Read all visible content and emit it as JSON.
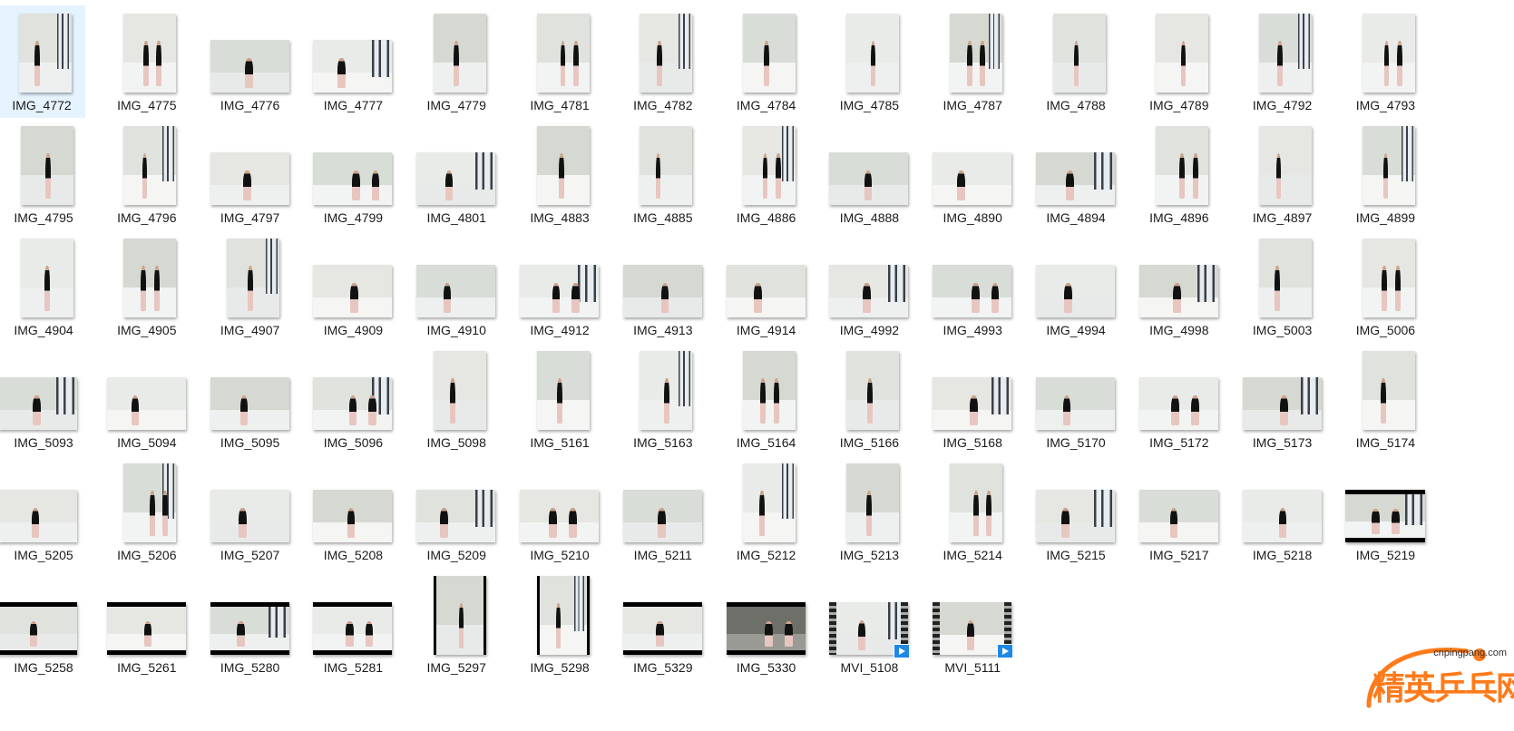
{
  "window": {
    "title": ""
  },
  "selected_index": 0,
  "colors": {
    "selection_bg": "#e5f3ff",
    "label_text": "#1a1a1a",
    "watermark_orange": "#ff7a1a",
    "video_badge": "#1e88e5"
  },
  "files": [
    {
      "name": "IMG_4772",
      "orientation": "portrait",
      "kind": "photo"
    },
    {
      "name": "IMG_4775",
      "orientation": "portrait",
      "kind": "photo"
    },
    {
      "name": "IMG_4776",
      "orientation": "landscape",
      "kind": "photo"
    },
    {
      "name": "IMG_4777",
      "orientation": "landscape",
      "kind": "photo"
    },
    {
      "name": "IMG_4779",
      "orientation": "portrait",
      "kind": "photo"
    },
    {
      "name": "IMG_4781",
      "orientation": "portrait",
      "kind": "photo"
    },
    {
      "name": "IMG_4782",
      "orientation": "portrait",
      "kind": "photo"
    },
    {
      "name": "IMG_4784",
      "orientation": "portrait",
      "kind": "photo"
    },
    {
      "name": "IMG_4785",
      "orientation": "portrait",
      "kind": "photo"
    },
    {
      "name": "IMG_4787",
      "orientation": "portrait",
      "kind": "photo"
    },
    {
      "name": "IMG_4788",
      "orientation": "portrait",
      "kind": "photo"
    },
    {
      "name": "IMG_4789",
      "orientation": "portrait",
      "kind": "photo"
    },
    {
      "name": "IMG_4792",
      "orientation": "portrait",
      "kind": "photo"
    },
    {
      "name": "IMG_4793",
      "orientation": "portrait",
      "kind": "photo"
    },
    {
      "name": "IMG_4795",
      "orientation": "portrait",
      "kind": "photo"
    },
    {
      "name": "IMG_4796",
      "orientation": "portrait",
      "kind": "photo"
    },
    {
      "name": "IMG_4797",
      "orientation": "landscape",
      "kind": "photo"
    },
    {
      "name": "IMG_4799",
      "orientation": "landscape",
      "kind": "photo"
    },
    {
      "name": "IMG_4801",
      "orientation": "landscape",
      "kind": "photo"
    },
    {
      "name": "IMG_4883",
      "orientation": "portrait",
      "kind": "photo"
    },
    {
      "name": "IMG_4885",
      "orientation": "portrait",
      "kind": "photo"
    },
    {
      "name": "IMG_4886",
      "orientation": "portrait",
      "kind": "photo"
    },
    {
      "name": "IMG_4888",
      "orientation": "landscape",
      "kind": "photo"
    },
    {
      "name": "IMG_4890",
      "orientation": "landscape",
      "kind": "photo"
    },
    {
      "name": "IMG_4894",
      "orientation": "landscape",
      "kind": "photo"
    },
    {
      "name": "IMG_4896",
      "orientation": "portrait",
      "kind": "photo"
    },
    {
      "name": "IMG_4897",
      "orientation": "portrait",
      "kind": "photo"
    },
    {
      "name": "IMG_4899",
      "orientation": "portrait",
      "kind": "photo"
    },
    {
      "name": "IMG_4904",
      "orientation": "portrait",
      "kind": "photo"
    },
    {
      "name": "IMG_4905",
      "orientation": "portrait",
      "kind": "photo"
    },
    {
      "name": "IMG_4907",
      "orientation": "portrait",
      "kind": "photo"
    },
    {
      "name": "IMG_4909",
      "orientation": "landscape",
      "kind": "photo"
    },
    {
      "name": "IMG_4910",
      "orientation": "landscape",
      "kind": "photo"
    },
    {
      "name": "IMG_4912",
      "orientation": "landscape",
      "kind": "photo"
    },
    {
      "name": "IMG_4913",
      "orientation": "landscape",
      "kind": "photo"
    },
    {
      "name": "IMG_4914",
      "orientation": "landscape",
      "kind": "photo"
    },
    {
      "name": "IMG_4992",
      "orientation": "landscape",
      "kind": "photo"
    },
    {
      "name": "IMG_4993",
      "orientation": "landscape",
      "kind": "photo"
    },
    {
      "name": "IMG_4994",
      "orientation": "landscape",
      "kind": "photo"
    },
    {
      "name": "IMG_4998",
      "orientation": "landscape",
      "kind": "photo"
    },
    {
      "name": "IMG_5003",
      "orientation": "portrait",
      "kind": "photo"
    },
    {
      "name": "IMG_5006",
      "orientation": "portrait",
      "kind": "photo"
    },
    {
      "name": "IMG_5093",
      "orientation": "landscape",
      "kind": "photo"
    },
    {
      "name": "IMG_5094",
      "orientation": "landscape",
      "kind": "photo"
    },
    {
      "name": "IMG_5095",
      "orientation": "landscape",
      "kind": "photo"
    },
    {
      "name": "IMG_5096",
      "orientation": "landscape",
      "kind": "photo"
    },
    {
      "name": "IMG_5098",
      "orientation": "portrait",
      "kind": "photo"
    },
    {
      "name": "IMG_5161",
      "orientation": "portrait",
      "kind": "photo"
    },
    {
      "name": "IMG_5163",
      "orientation": "portrait",
      "kind": "photo"
    },
    {
      "name": "IMG_5164",
      "orientation": "portrait",
      "kind": "photo"
    },
    {
      "name": "IMG_5166",
      "orientation": "portrait",
      "kind": "photo"
    },
    {
      "name": "IMG_5168",
      "orientation": "landscape",
      "kind": "photo"
    },
    {
      "name": "IMG_5170",
      "orientation": "landscape",
      "kind": "photo"
    },
    {
      "name": "IMG_5172",
      "orientation": "landscape",
      "kind": "photo"
    },
    {
      "name": "IMG_5173",
      "orientation": "landscape",
      "kind": "photo"
    },
    {
      "name": "IMG_5174",
      "orientation": "portrait",
      "kind": "photo"
    },
    {
      "name": "IMG_5205",
      "orientation": "landscape",
      "kind": "photo"
    },
    {
      "name": "IMG_5206",
      "orientation": "portrait",
      "kind": "photo"
    },
    {
      "name": "IMG_5207",
      "orientation": "landscape",
      "kind": "photo"
    },
    {
      "name": "IMG_5208",
      "orientation": "landscape",
      "kind": "photo"
    },
    {
      "name": "IMG_5209",
      "orientation": "landscape",
      "kind": "photo"
    },
    {
      "name": "IMG_5210",
      "orientation": "landscape",
      "kind": "photo"
    },
    {
      "name": "IMG_5211",
      "orientation": "landscape",
      "kind": "photo"
    },
    {
      "name": "IMG_5212",
      "orientation": "portrait",
      "kind": "photo"
    },
    {
      "name": "IMG_5213",
      "orientation": "portrait",
      "kind": "photo"
    },
    {
      "name": "IMG_5214",
      "orientation": "portrait",
      "kind": "photo"
    },
    {
      "name": "IMG_5215",
      "orientation": "landscape",
      "kind": "photo"
    },
    {
      "name": "IMG_5217",
      "orientation": "landscape",
      "kind": "photo"
    },
    {
      "name": "IMG_5218",
      "orientation": "landscape",
      "kind": "photo"
    },
    {
      "name": "IMG_5219",
      "orientation": "pano",
      "kind": "photo"
    },
    {
      "name": "IMG_5258",
      "orientation": "pano",
      "kind": "photo"
    },
    {
      "name": "IMG_5261",
      "orientation": "pano",
      "kind": "photo"
    },
    {
      "name": "IMG_5280",
      "orientation": "pano",
      "kind": "photo"
    },
    {
      "name": "IMG_5281",
      "orientation": "pano",
      "kind": "photo"
    },
    {
      "name": "IMG_5297",
      "orientation": "portrait-bars",
      "kind": "photo"
    },
    {
      "name": "IMG_5298",
      "orientation": "portrait-bars",
      "kind": "photo"
    },
    {
      "name": "IMG_5329",
      "orientation": "pano",
      "kind": "photo"
    },
    {
      "name": "IMG_5330",
      "orientation": "pano-dark",
      "kind": "photo"
    },
    {
      "name": "MVI_5108",
      "orientation": "landscape",
      "kind": "video"
    },
    {
      "name": "MVI_5111",
      "orientation": "landscape",
      "kind": "video"
    }
  ],
  "watermark": {
    "site": "cnpingpang.com",
    "text": "精英乒乓网"
  }
}
